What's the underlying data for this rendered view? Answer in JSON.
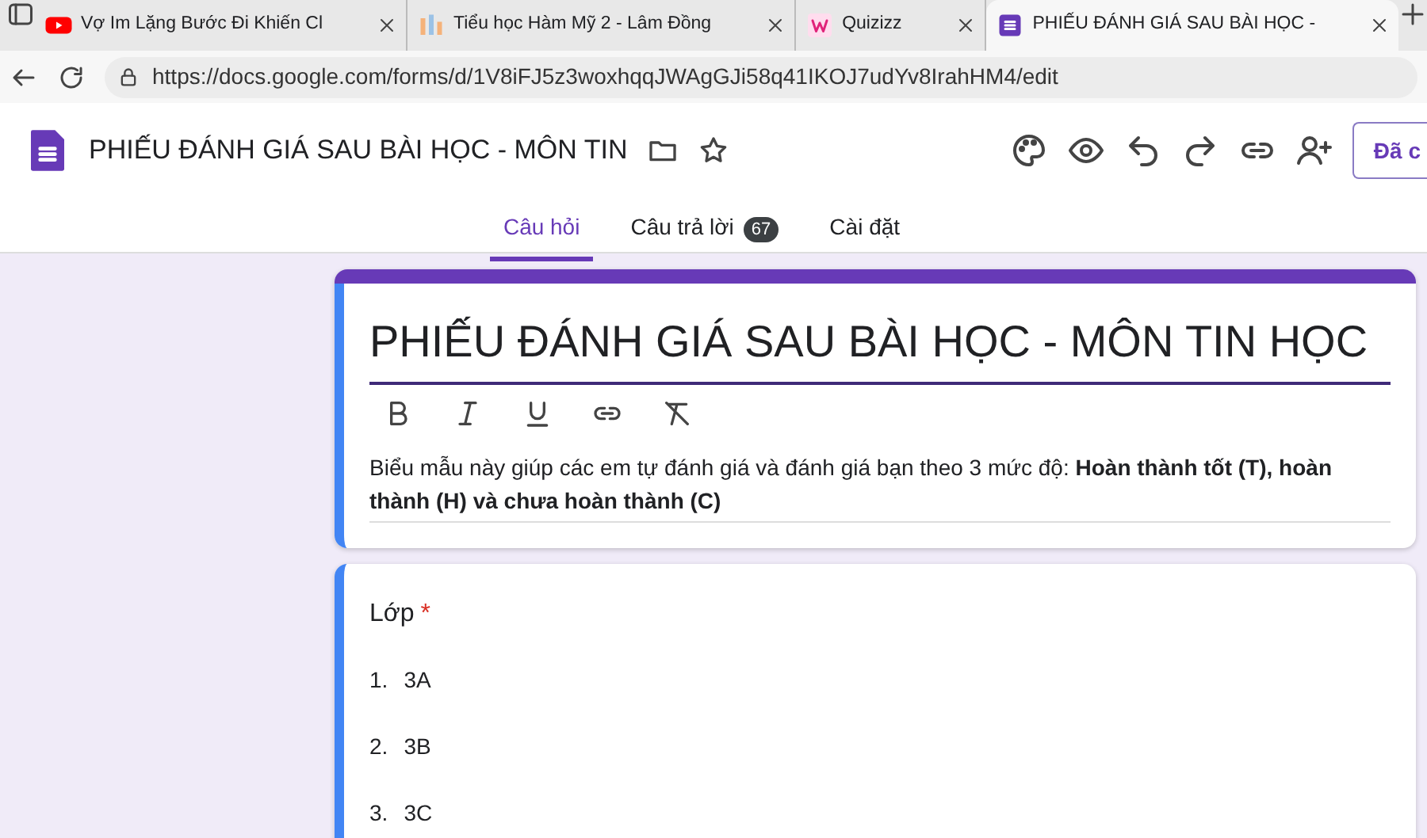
{
  "browser_tabs": [
    {
      "title": "Vợ Im Lặng Bước Đi Khiến Cl",
      "kind": "youtube",
      "selected": false
    },
    {
      "title": "Tiểu học Hàm Mỹ 2 - Lâm Đồng",
      "kind": "site",
      "selected": false
    },
    {
      "title": "Quizizz",
      "kind": "quizizz",
      "selected": false
    },
    {
      "title": "PHIẾU ĐÁNH GIÁ SAU BÀI HỌC -",
      "kind": "forms",
      "selected": true
    }
  ],
  "address_bar": {
    "url": "https://docs.google.com/forms/d/1V8iFJ5z3woxhqqJWAgGJi58q41IKOJ7udYv8IrahHM4/edit"
  },
  "app_header": {
    "document_title": "PHIẾU ĐÁNH GIÁ SAU BÀI HỌC - MÔN TIN",
    "send_button": "Đã c"
  },
  "form_tabs": [
    {
      "label": "Câu hỏi",
      "selected": true
    },
    {
      "label": "Câu trả lời",
      "badge": "67",
      "selected": false
    },
    {
      "label": "Cài đặt",
      "selected": false
    }
  ],
  "form_header": {
    "title": "PHIẾU ĐÁNH GIÁ SAU BÀI HỌC - MÔN TIN HỌC",
    "description": "Biểu mẫu này giúp các em tự đánh giá và đánh giá bạn theo 3 mức độ: **Hoàn thành tốt (T), hoàn thành (H) và chưa hoàn thành (C)**"
  },
  "question": {
    "title": "Lớp",
    "required": true,
    "required_mark": "*",
    "options": [
      {
        "number": "1.",
        "label": "3A"
      },
      {
        "number": "2.",
        "label": "3B"
      },
      {
        "number": "3.",
        "label": "3C"
      }
    ]
  }
}
